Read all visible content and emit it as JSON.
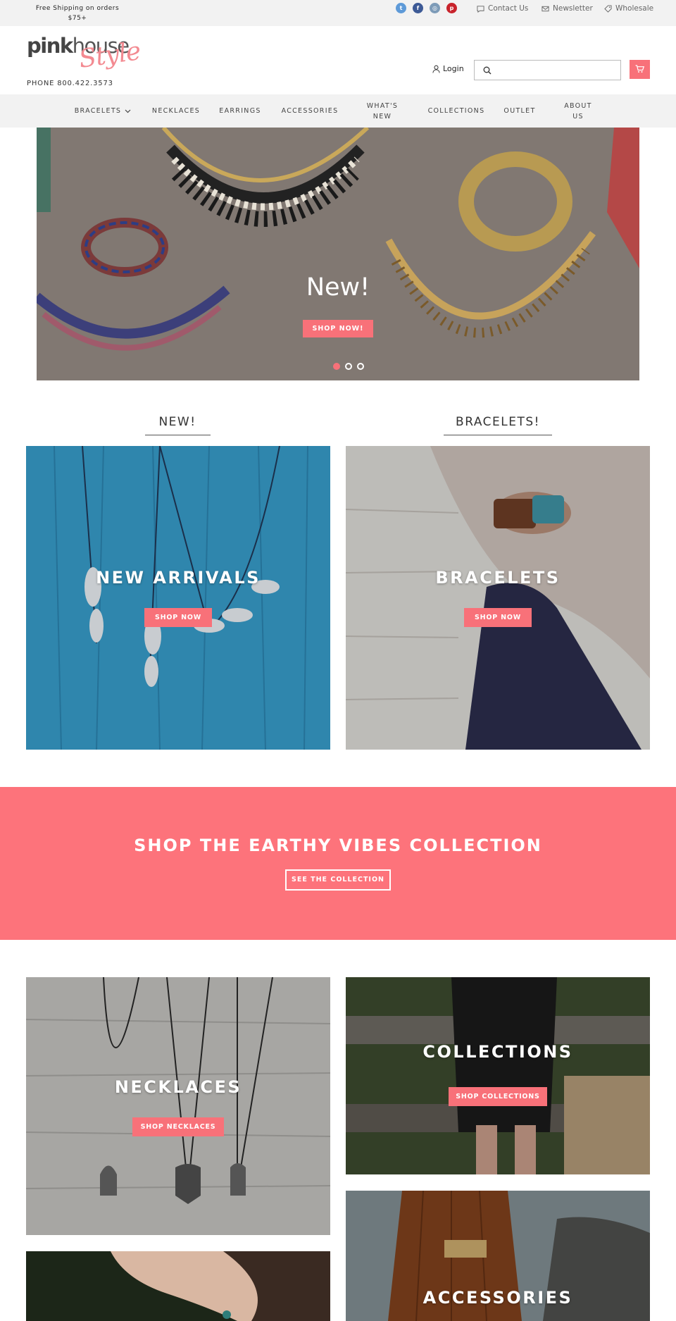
{
  "topbar": {
    "promo": "Free Shipping on orders $75+",
    "social": [
      {
        "icon": "twitter-icon",
        "glyph": "t",
        "color": "#5e9ad8"
      },
      {
        "icon": "facebook-icon",
        "glyph": "f",
        "color": "#3d5a96"
      },
      {
        "icon": "instagram-icon",
        "glyph": "◎",
        "color": "#7d9bb8"
      },
      {
        "icon": "pinterest-icon",
        "glyph": "p",
        "color": "#c8232c"
      }
    ],
    "contact": "Contact Us",
    "newsletter": "Newsletter",
    "wholesale": "Wholesale"
  },
  "header": {
    "logo_main": "pink",
    "logo_light": "house",
    "logo_script": "Style",
    "phone": "PHONE 800.422.3573",
    "login": "Login",
    "search_placeholder": ""
  },
  "nav": {
    "bracelets": "BRACELETS",
    "necklaces": "NECKLACES",
    "earrings": "EARRINGS",
    "accessories": "ACCESSORIES",
    "whats_new_1": "WHAT'S",
    "whats_new_2": "NEW",
    "collections": "COLLECTIONS",
    "outlet": "OUTLET",
    "about_1": "ABOUT",
    "about_2": "US"
  },
  "hero": {
    "title": "New!",
    "button": "SHOP NOW!"
  },
  "sections": {
    "new_heading": "NEW!",
    "bracelets_heading": "BRACELETS!"
  },
  "tiles": {
    "new_arrivals": {
      "title": "NEW ARRIVALS",
      "button": "SHOP NOW"
    },
    "bracelets": {
      "title": "BRACELETS",
      "button": "SHOP NOW"
    },
    "necklaces": {
      "title": "NECKLACES",
      "button": "SHOP NECKLACES"
    },
    "collections": {
      "title": "COLLECTIONS",
      "button": "SHOP COLLECTIONS"
    },
    "accessories": {
      "title": "ACCESSORIES"
    }
  },
  "banner": {
    "title": "SHOP THE EARTHY VIBES COLLECTION",
    "button": "SEE THE COLLECTION"
  },
  "colors": {
    "accent": "#f87179",
    "banner": "#fd737b",
    "topbar": "#f2f2f2"
  }
}
